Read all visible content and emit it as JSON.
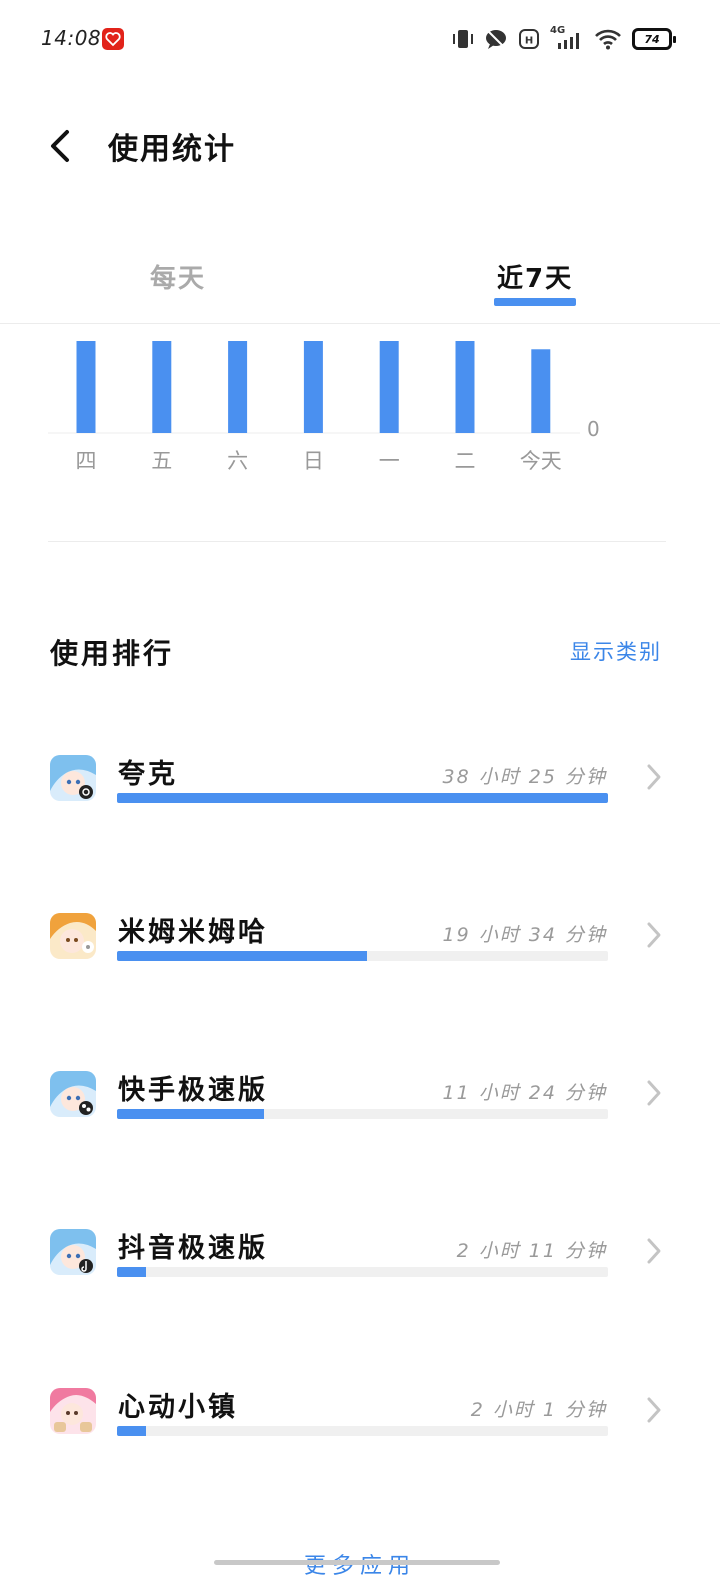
{
  "status_bar": {
    "time": "14:08",
    "network": "4G",
    "battery": "74"
  },
  "header": {
    "title": "使用统计"
  },
  "tabs": [
    {
      "label": "每天",
      "active": false
    },
    {
      "label": "近7天",
      "active": true
    }
  ],
  "chart_data": {
    "type": "bar",
    "categories": [
      "四",
      "五",
      "六",
      "日",
      "一",
      "二",
      "今天"
    ],
    "values": [
      100,
      100,
      100,
      100,
      100,
      100,
      91
    ],
    "y_min_label": "0",
    "color": "#4a90f0"
  },
  "ranking": {
    "title": "使用排行",
    "show_category": "显示类别"
  },
  "apps": [
    {
      "name": "夸克",
      "time": "38 小时 25 分钟",
      "fraction": 1.0,
      "icon": "quark-app-icon"
    },
    {
      "name": "米姆米姆哈",
      "time": "19 小时 34 分钟",
      "fraction": 0.51,
      "icon": "mimumimuha-app-icon"
    },
    {
      "name": "快手极速版",
      "time": "11 小时 24 分钟",
      "fraction": 0.3,
      "icon": "kuaishou-app-icon"
    },
    {
      "name": "抖音极速版",
      "time": "2 小时 11 分钟",
      "fraction": 0.06,
      "icon": "douyin-app-icon"
    },
    {
      "name": "心动小镇",
      "time": "2 小时 1 分钟",
      "fraction": 0.06,
      "icon": "xindong-app-icon"
    }
  ],
  "footer": {
    "more_apps": "更多应用"
  }
}
